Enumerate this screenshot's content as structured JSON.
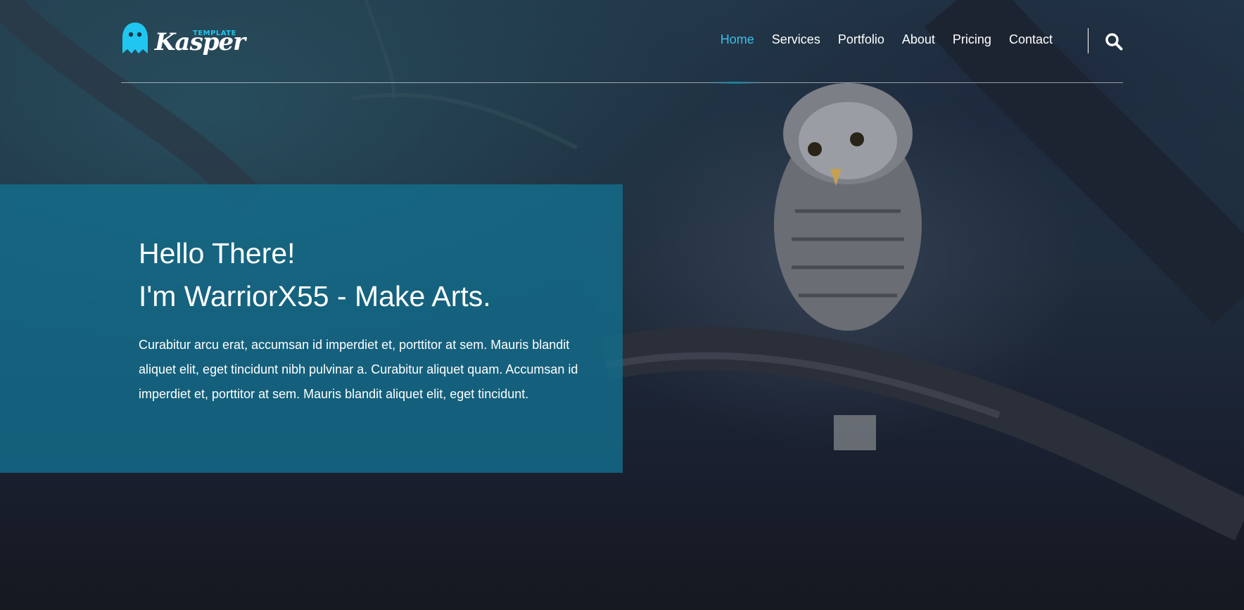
{
  "logo": {
    "word": "Kasper",
    "tag": "TEMPLATE",
    "icon": "ghost-icon"
  },
  "nav": {
    "items": [
      {
        "label": "Home",
        "active": true
      },
      {
        "label": "Services"
      },
      {
        "label": "Portfolio"
      },
      {
        "label": "About"
      },
      {
        "label": "Pricing"
      },
      {
        "label": "Contact"
      }
    ],
    "search_icon": "search-icon"
  },
  "hero": {
    "title_line1": "Hello There!",
    "title_line2": "I'm WarriorX55 - Make Arts.",
    "text": "Curabitur arcu erat, accumsan id imperdiet et, porttitor at sem. Mauris blandit aliquet elit, eget tincidunt nibh pulvinar a. Curabitur aliquet quam. Accumsan id imperdiet et, porttitor at sem. Mauris blandit aliquet elit, eget tincidunt."
  },
  "colors": {
    "accent": "#3dbde8",
    "panel": "#146e8c",
    "text": "#ffffff"
  }
}
